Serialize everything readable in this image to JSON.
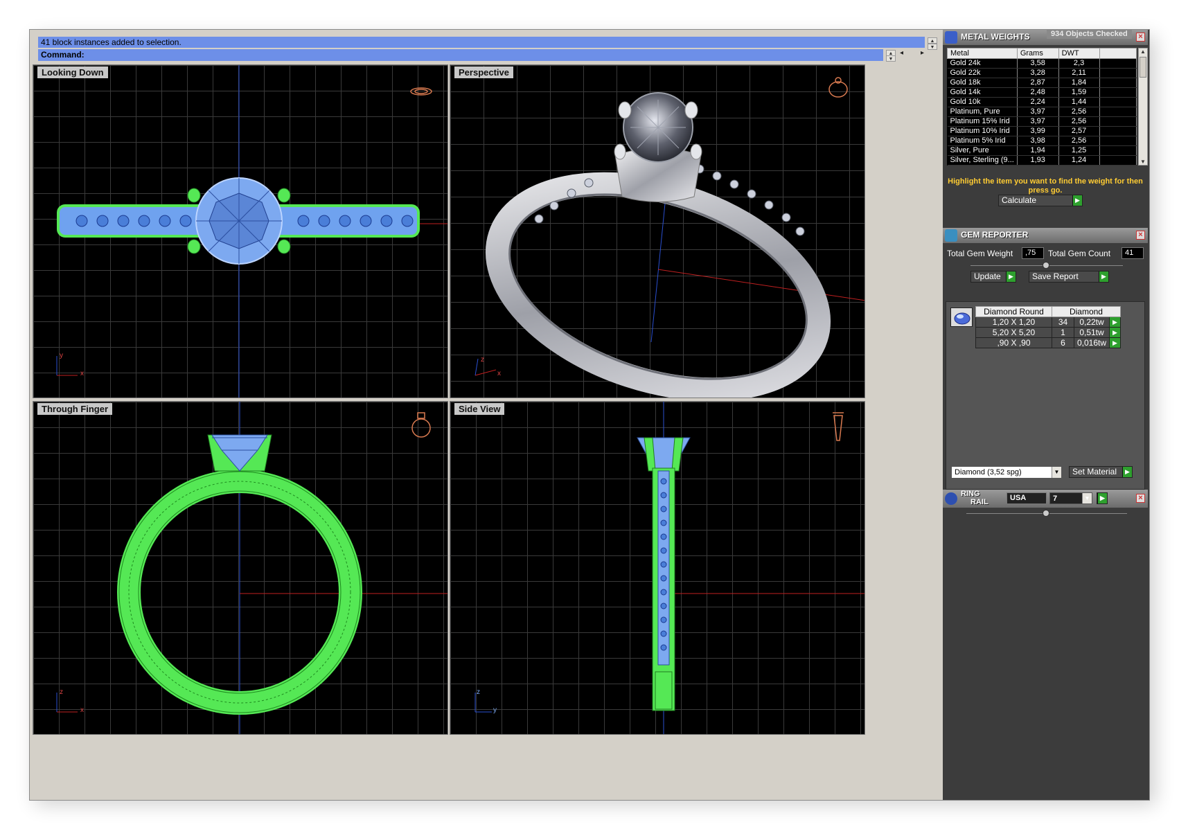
{
  "command": {
    "history": "41 block instances added to selection.",
    "prompt": "Command:",
    "value": ""
  },
  "viewports": [
    {
      "title": "Looking Down"
    },
    {
      "title": "Perspective"
    },
    {
      "title": "Through Finger"
    },
    {
      "title": "Side View"
    }
  ],
  "axes": {
    "x": "x",
    "y": "y",
    "z": "z"
  },
  "metal_weights": {
    "title": "METAL WEIGHTS",
    "objects_checked": "934 Objects Checked",
    "columns": [
      "Metal",
      "Grams",
      "DWT"
    ],
    "rows": [
      [
        "Gold 24k",
        "3,58",
        "2,3"
      ],
      [
        "Gold 22k",
        "3,28",
        "2,11"
      ],
      [
        "Gold 18k",
        "2,87",
        "1,84"
      ],
      [
        "Gold 14k",
        "2,48",
        "1,59"
      ],
      [
        "Gold 10k",
        "2,24",
        "1,44"
      ],
      [
        "Platinum, Pure",
        "3,97",
        "2,56"
      ],
      [
        "Platinum 15% Irid",
        "3,97",
        "2,56"
      ],
      [
        "Platinum 10% Irid",
        "3,99",
        "2,57"
      ],
      [
        "Platinum 5% Irid",
        "3,98",
        "2,56"
      ],
      [
        "Silver, Pure",
        "1,94",
        "1,25"
      ],
      [
        "Silver, Sterling (9...",
        "1,93",
        "1,24"
      ]
    ],
    "hint": "Highlight the item you want to find the weight for then press go.",
    "calculate_label": "Calculate"
  },
  "gem_reporter": {
    "title": "GEM REPORTER",
    "total_weight_label": "Total Gem Weight",
    "total_weight_value": ",75",
    "total_count_label": "Total Gem Count",
    "total_count_value": "41",
    "update_label": "Update",
    "save_report_label": "Save Report",
    "table_headers": [
      "Diamond Round",
      "Diamond"
    ],
    "rows": [
      [
        "1,20 X 1,20",
        "34",
        "0,22tw"
      ],
      [
        "5,20 X 5,20",
        "1",
        "0,51tw"
      ],
      [
        ",90 X ,90",
        "6",
        "0,016tw"
      ]
    ],
    "material_value": "Diamond    (3,52 spg)",
    "set_material_label": "Set Material"
  },
  "ring_rail": {
    "title_line1": "RING",
    "title_line2": "RAIL",
    "standard_value": "USA",
    "size_value": "7"
  },
  "colors": {
    "command_bar": "#6d8fe8",
    "wire_green": "#55e855",
    "wire_blue": "#7da9f0",
    "go_green": "#2ea02e",
    "hint_yellow": "#ffcc33"
  }
}
